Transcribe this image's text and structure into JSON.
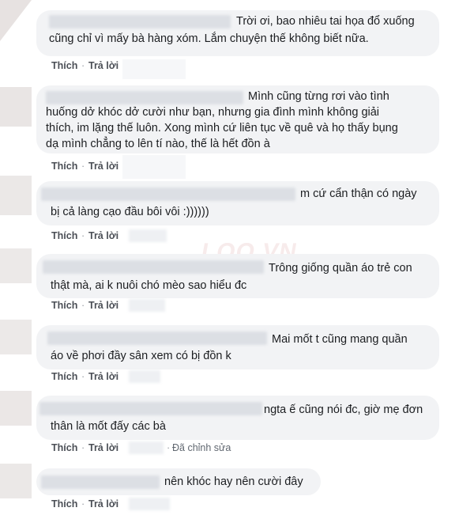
{
  "comments": [
    {
      "lines": [
        "Trời ơi, bao nhiêu tai họa đổ xuống",
        "cũng chỉ vì mấy bà hàng xóm. Lắm chuyện thế không biết nữa."
      ],
      "actions": {
        "like": "Thích",
        "reply": "Trả lời",
        "sep": "·"
      }
    },
    {
      "lines": [
        "Mình cũng từng rơi vào tình",
        "huống dở khóc dở cười như bạn, nhưng gia đình mình không giải",
        "thích, im lặng thế luôn. Xong mình cứ liên tục về quê và họ thấy bụng",
        "dạ mình chẳng to lên tí nào, thế là hết đồn à"
      ],
      "actions": {
        "like": "Thích",
        "reply": "Trả lời",
        "sep": "·"
      }
    },
    {
      "lines": [
        "m cứ cẩn thận có ngày",
        "bị cả làng cạo đầu bôi vôi :))))))"
      ],
      "actions": {
        "like": "Thích",
        "reply": "Trả lời",
        "sep": "·"
      }
    },
    {
      "lines": [
        "Trông giống quần áo trẻ con",
        "thật mà, ai k nuôi chó mèo sao hiểu đc"
      ],
      "actions": {
        "like": "Thích",
        "reply": "Trả lời",
        "sep": "·"
      }
    },
    {
      "lines": [
        "Mai mốt t cũng mang quần",
        "áo về phơi đầy sân xem có bị đồn k"
      ],
      "actions": {
        "like": "Thích",
        "reply": "Trả lời",
        "sep": "·"
      }
    },
    {
      "lines": [
        "ngta ế cũng nói đc, giờ mẹ đơn",
        "thân là mốt đấy các bà"
      ],
      "actions": {
        "like": "Thích",
        "reply": "Trả lời",
        "sep": "·",
        "edited": "Đã chỉnh sửa"
      }
    },
    {
      "lines": [
        "nên khóc hay nên cười đây"
      ],
      "actions": {
        "like": "Thích",
        "reply": "Trả lời",
        "sep": "·"
      }
    }
  ]
}
